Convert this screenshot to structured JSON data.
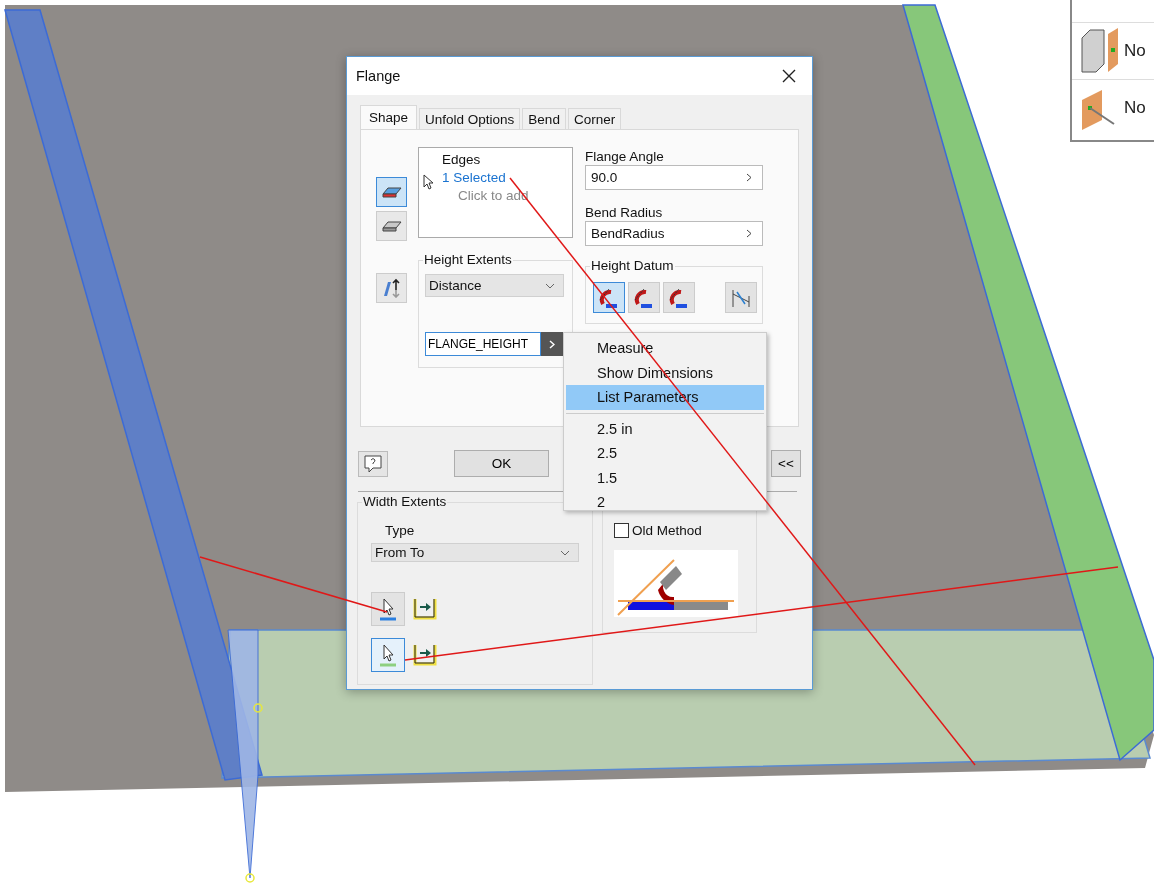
{
  "dialog": {
    "title": "Flange",
    "tabs": [
      {
        "label": "Shape",
        "selected": true
      },
      {
        "label": "Unfold Options",
        "selected": false
      },
      {
        "label": "Bend",
        "selected": false
      },
      {
        "label": "Corner",
        "selected": false
      }
    ],
    "mode_buttons": [
      {
        "selected": true
      },
      {
        "selected": false
      }
    ],
    "edges": {
      "label": "Edges",
      "value": "1 Selected",
      "hint": "Click to add"
    },
    "flange_angle": {
      "label": "Flange Angle",
      "value": "90.0"
    },
    "bend_radius": {
      "label": "Bend Radius",
      "value": "BendRadius"
    },
    "height_extents": {
      "label": "Height Extents",
      "type": "Distance",
      "value": "FLANGE_HEIGHT"
    },
    "height_datum": {
      "label": "Height Datum",
      "options": [
        {
          "selected": true
        },
        {
          "selected": false
        },
        {
          "selected": false
        }
      ]
    },
    "buttons": [
      "OK"
    ],
    "collapse": "<<",
    "width_extents": {
      "label": "Width Extents",
      "type_label": "Type",
      "type": "From To",
      "pickers": [
        {
          "selected": false
        },
        {
          "selected": true
        }
      ]
    },
    "design": {
      "checkbox": {
        "label": "Old Method",
        "checked": false
      }
    }
  },
  "context_menu": {
    "commands": [
      {
        "label": "Measure",
        "selected": false
      },
      {
        "label": "Show Dimensions",
        "selected": false
      },
      {
        "label": "List Parameters",
        "selected": true
      }
    ],
    "values": [
      {
        "label": "2.5 in",
        "selected": false
      },
      {
        "label": "2.5",
        "selected": false
      },
      {
        "label": "1.5",
        "selected": false
      },
      {
        "label": "2",
        "selected": false
      }
    ]
  },
  "side_panel": {
    "items": [
      {
        "label": "No",
        "kind": "box"
      },
      {
        "label": "No",
        "kind": "plane"
      }
    ]
  }
}
